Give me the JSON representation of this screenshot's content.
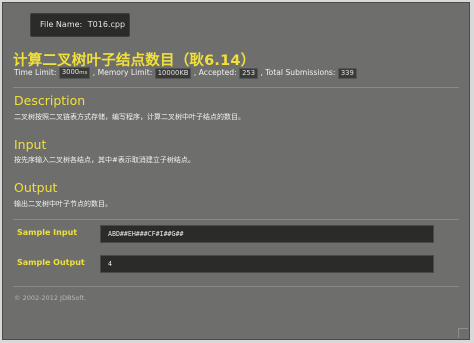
{
  "file_tab": {
    "label": "File Name:",
    "file_name": "T016.cpp"
  },
  "problem": {
    "title": "计算二叉树叶子结点数目（耿6.14）"
  },
  "stats": {
    "time_limit_label": "Time Limit:",
    "time_limit_value": "3000",
    "time_limit_unit": "ms",
    "memory_limit_label": ", Memory Limit:",
    "memory_limit_value": "10000KB",
    "accepted_label": ", Accepted:",
    "accepted_value": "253",
    "submissions_label": ", Total Submissions:",
    "submissions_value": "339"
  },
  "sections": {
    "description_heading": "Description",
    "description_text": "二叉树按照二叉链表方式存储，编写程序，计算二叉树中叶子结点的数目。",
    "input_heading": "Input",
    "input_text": "按先序输入二叉树各结点，其中#表示取消建立子树结点。",
    "output_heading": "Output",
    "output_text": "输出二叉树中叶子节点的数目。"
  },
  "samples": {
    "input_label": "Sample Input",
    "input_value": "ABD##EH###CF#I##G##",
    "output_label": "Sample Output",
    "output_value": "4"
  },
  "footer": {
    "text": "© 2002-2012  JDBSoft."
  }
}
